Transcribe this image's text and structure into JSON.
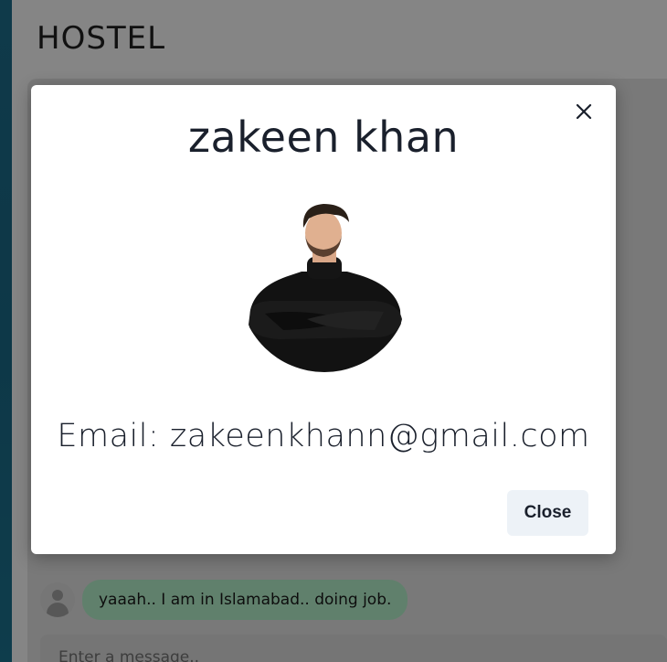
{
  "app": {
    "title": "HOSTEL"
  },
  "chat": {
    "messages": [
      {
        "text": "yaaah.. I am in Islamabad.. doing job."
      }
    ],
    "input_placeholder": "Enter a message.."
  },
  "profile_modal": {
    "name": "zakeen khan",
    "email_label": "Email: zakeenkhann@gmail.com",
    "close_button_label": "Close",
    "close_icon": "close-icon",
    "photo": "profile-photo"
  },
  "colors": {
    "bubble": "#b9f5d0",
    "close_button_bg": "#edf2f7",
    "text": "#1a202c",
    "overlay": "rgba(0,0,0,0.48)"
  }
}
